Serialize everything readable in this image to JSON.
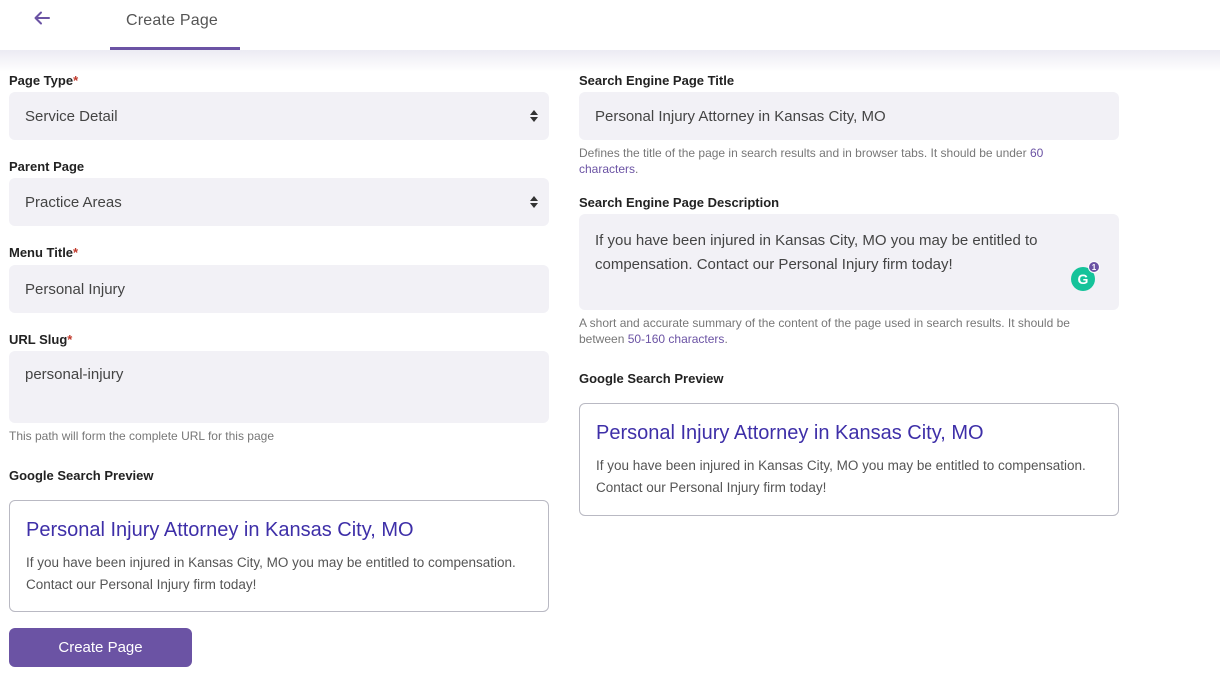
{
  "header": {
    "tab_label": "Create Page"
  },
  "left": {
    "page_type": {
      "label": "Page Type",
      "required_mark": "*",
      "value": "Service Detail"
    },
    "parent_page": {
      "label": "Parent Page",
      "value": "Practice Areas"
    },
    "menu_title": {
      "label": "Menu Title",
      "required_mark": "*",
      "value": "Personal Injury"
    },
    "url_slug": {
      "label": "URL Slug",
      "required_mark": "*",
      "value": "personal-injury",
      "help": "This path will form the complete URL for this page"
    },
    "google_preview": {
      "label": "Google Search Preview",
      "title": "Personal Injury Attorney in Kansas City, MO",
      "description": "If you have been injured in Kansas City, MO you may be entitled to compensation. Contact our Personal Injury firm today!"
    },
    "create_button": "Create Page"
  },
  "right": {
    "seo_title": {
      "label": "Search Engine Page Title",
      "value": "Personal Injury Attorney in Kansas City, MO",
      "help_prefix": "Defines the title of the page in search results and in browser tabs. It should be under ",
      "help_highlight": "60 characters",
      "help_suffix": "."
    },
    "seo_description": {
      "label": "Search Engine Page Description",
      "value": "If you have been injured in Kansas City, MO you may be entitled to compensation. Contact our Personal Injury firm today!",
      "help_prefix": "A short and accurate summary of the content of the page used in search results. It should be between ",
      "help_highlight": "50-160 characters",
      "help_suffix": ".",
      "grammarly_letter": "G",
      "grammarly_count": "1"
    },
    "google_preview": {
      "label": "Google Search Preview",
      "title": "Personal Injury Attorney in Kansas City, MO",
      "description": "If you have been injured in Kansas City, MO you may be entitled to compensation. Contact our Personal Injury firm today!"
    }
  },
  "colors": {
    "accent": "#6b53a4",
    "link_title": "#3e2fa8",
    "field_bg": "#f2f1f6",
    "required": "#c0392b"
  },
  "icons": [
    "arrow-left-icon",
    "select-arrows-icon",
    "grammarly-icon"
  ]
}
